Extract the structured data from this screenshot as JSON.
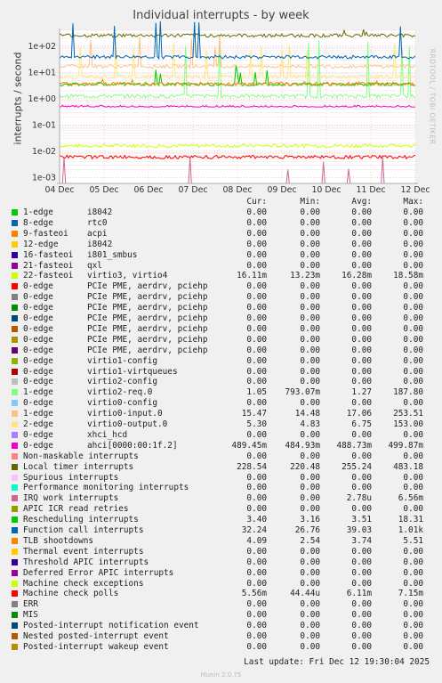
{
  "chart_data": {
    "type": "line",
    "title": "Individual interrupts - by week",
    "ylabel": "interrupts / second",
    "yscale": "log",
    "ylim": [
      0.0006,
      400
    ],
    "yticks": [
      "1e+02",
      "1e+01",
      "1e+00",
      "1e-01",
      "1e-02",
      "1e-03"
    ],
    "xticks": [
      "04 Dec",
      "05 Dec",
      "06 Dec",
      "07 Dec",
      "08 Dec",
      "09 Dec",
      "10 Dec",
      "11 Dec",
      "12 Dec"
    ],
    "grid": true,
    "columns": [
      "Cur:",
      "Min:",
      "Avg:",
      "Max:"
    ],
    "series": [
      {
        "name": "1-edge",
        "desc": "i8042",
        "color": "#00cc00",
        "cur": "0.00",
        "min": "0.00",
        "avg": "0.00",
        "max": "0.00"
      },
      {
        "name": "8-edge",
        "desc": "rtc0",
        "color": "#0066b3",
        "cur": "0.00",
        "min": "0.00",
        "avg": "0.00",
        "max": "0.00"
      },
      {
        "name": "9-fasteoi",
        "desc": "acpi",
        "color": "#ff8000",
        "cur": "0.00",
        "min": "0.00",
        "avg": "0.00",
        "max": "0.00"
      },
      {
        "name": "12-edge",
        "desc": "i8042",
        "color": "#ffcc00",
        "cur": "0.00",
        "min": "0.00",
        "avg": "0.00",
        "max": "0.00"
      },
      {
        "name": "16-fasteoi",
        "desc": "i801_smbus",
        "color": "#330099",
        "cur": "0.00",
        "min": "0.00",
        "avg": "0.00",
        "max": "0.00"
      },
      {
        "name": "21-fasteoi",
        "desc": "qxl",
        "color": "#990099",
        "cur": "0.00",
        "min": "0.00",
        "avg": "0.00",
        "max": "0.00"
      },
      {
        "name": "22-fasteoi",
        "desc": "virtio3, virtio4",
        "color": "#ccff00",
        "cur": "16.11m",
        "min": "13.23m",
        "avg": "16.28m",
        "max": "18.58m"
      },
      {
        "name": "0-edge",
        "desc": "PCIe PME, aerdrv, pciehp",
        "color": "#ff0000",
        "cur": "0.00",
        "min": "0.00",
        "avg": "0.00",
        "max": "0.00"
      },
      {
        "name": "0-edge",
        "desc": "PCIe PME, aerdrv, pciehp",
        "color": "#808080",
        "cur": "0.00",
        "min": "0.00",
        "avg": "0.00",
        "max": "0.00"
      },
      {
        "name": "0-edge",
        "desc": "PCIe PME, aerdrv, pciehp",
        "color": "#008f00",
        "cur": "0.00",
        "min": "0.00",
        "avg": "0.00",
        "max": "0.00"
      },
      {
        "name": "0-edge",
        "desc": "PCIe PME, aerdrv, pciehp",
        "color": "#00487d",
        "cur": "0.00",
        "min": "0.00",
        "avg": "0.00",
        "max": "0.00"
      },
      {
        "name": "0-edge",
        "desc": "PCIe PME, aerdrv, pciehp",
        "color": "#b35a00",
        "cur": "0.00",
        "min": "0.00",
        "avg": "0.00",
        "max": "0.00"
      },
      {
        "name": "0-edge",
        "desc": "PCIe PME, aerdrv, pciehp",
        "color": "#b38f00",
        "cur": "0.00",
        "min": "0.00",
        "avg": "0.00",
        "max": "0.00"
      },
      {
        "name": "0-edge",
        "desc": "PCIe PME, aerdrv, pciehp",
        "color": "#6b006b",
        "cur": "0.00",
        "min": "0.00",
        "avg": "0.00",
        "max": "0.00"
      },
      {
        "name": "0-edge",
        "desc": "virtio1-config",
        "color": "#8fb300",
        "cur": "0.00",
        "min": "0.00",
        "avg": "0.00",
        "max": "0.00"
      },
      {
        "name": "0-edge",
        "desc": "virtio1-virtqueues",
        "color": "#b30000",
        "cur": "0.00",
        "min": "0.00",
        "avg": "0.00",
        "max": "0.00"
      },
      {
        "name": "0-edge",
        "desc": "virtio2-config",
        "color": "#bebebe",
        "cur": "0.00",
        "min": "0.00",
        "avg": "0.00",
        "max": "0.00"
      },
      {
        "name": "1-edge",
        "desc": "virtio2-req.0",
        "color": "#80ff80",
        "cur": "1.05",
        "min": "793.07m",
        "avg": "1.27",
        "max": "187.80"
      },
      {
        "name": "0-edge",
        "desc": "virtio0-config",
        "color": "#80c9ff",
        "cur": "0.00",
        "min": "0.00",
        "avg": "0.00",
        "max": "0.00"
      },
      {
        "name": "1-edge",
        "desc": "virtio0-input.0",
        "color": "#ffc080",
        "cur": "15.47",
        "min": "14.48",
        "avg": "17.06",
        "max": "253.51"
      },
      {
        "name": "2-edge",
        "desc": "virtio0-output.0",
        "color": "#ffe680",
        "cur": "5.30",
        "min": "4.83",
        "avg": "6.75",
        "max": "153.00"
      },
      {
        "name": "0-edge",
        "desc": "xhci_hcd",
        "color": "#aa80ff",
        "cur": "0.00",
        "min": "0.00",
        "avg": "0.00",
        "max": "0.00"
      },
      {
        "name": "0-edge",
        "desc": "ahci[0000:00:1f.2]",
        "color": "#ee00cc",
        "cur": "489.45m",
        "min": "484.93m",
        "avg": "488.73m",
        "max": "499.87m"
      },
      {
        "name": "Non-maskable interrupts",
        "desc": "",
        "color": "#ff8080",
        "cur": "0.00",
        "min": "0.00",
        "avg": "0.00",
        "max": "0.00"
      },
      {
        "name": "Local timer interrupts",
        "desc": "",
        "color": "#666600",
        "cur": "228.54",
        "min": "220.48",
        "avg": "255.24",
        "max": "483.18"
      },
      {
        "name": "Spurious interrupts",
        "desc": "",
        "color": "#ffbfff",
        "cur": "0.00",
        "min": "0.00",
        "avg": "0.00",
        "max": "0.00"
      },
      {
        "name": "Performance monitoring interrupts",
        "desc": "",
        "color": "#00ffcc",
        "cur": "0.00",
        "min": "0.00",
        "avg": "0.00",
        "max": "0.00"
      },
      {
        "name": "IRQ work interrupts",
        "desc": "",
        "color": "#cc6699",
        "cur": "0.00",
        "min": "0.00",
        "avg": "2.78u",
        "max": "6.56m"
      },
      {
        "name": "APIC ICR read retries",
        "desc": "",
        "color": "#999900",
        "cur": "0.00",
        "min": "0.00",
        "avg": "0.00",
        "max": "0.00"
      },
      {
        "name": "Rescheduling interrupts",
        "desc": "",
        "color": "#00cc00",
        "cur": "3.40",
        "min": "3.16",
        "avg": "3.51",
        "max": "18.31"
      },
      {
        "name": "Function call interrupts",
        "desc": "",
        "color": "#0066b3",
        "cur": "32.24",
        "min": "26.76",
        "avg": "39.03",
        "max": "1.01k"
      },
      {
        "name": "TLB shootdowns",
        "desc": "",
        "color": "#ff8000",
        "cur": "4.09",
        "min": "2.54",
        "avg": "3.74",
        "max": "5.51"
      },
      {
        "name": "Thermal event interrupts",
        "desc": "",
        "color": "#ffcc00",
        "cur": "0.00",
        "min": "0.00",
        "avg": "0.00",
        "max": "0.00"
      },
      {
        "name": "Threshold APIC interrupts",
        "desc": "",
        "color": "#330099",
        "cur": "0.00",
        "min": "0.00",
        "avg": "0.00",
        "max": "0.00"
      },
      {
        "name": "Deferred Error APIC interrupts",
        "desc": "",
        "color": "#990099",
        "cur": "0.00",
        "min": "0.00",
        "avg": "0.00",
        "max": "0.00"
      },
      {
        "name": "Machine check exceptions",
        "desc": "",
        "color": "#ccff00",
        "cur": "0.00",
        "min": "0.00",
        "avg": "0.00",
        "max": "0.00"
      },
      {
        "name": "Machine check polls",
        "desc": "",
        "color": "#ff0000",
        "cur": "5.56m",
        "min": "44.44u",
        "avg": "6.11m",
        "max": "7.15m"
      },
      {
        "name": "ERR",
        "desc": "",
        "color": "#808080",
        "cur": "0.00",
        "min": "0.00",
        "avg": "0.00",
        "max": "0.00"
      },
      {
        "name": "MIS",
        "desc": "",
        "color": "#008f00",
        "cur": "0.00",
        "min": "0.00",
        "avg": "0.00",
        "max": "0.00"
      },
      {
        "name": "Posted-interrupt notification event",
        "desc": "",
        "color": "#00487d",
        "cur": "0.00",
        "min": "0.00",
        "avg": "0.00",
        "max": "0.00"
      },
      {
        "name": "Nested posted-interrupt event",
        "desc": "",
        "color": "#b35a00",
        "cur": "0.00",
        "min": "0.00",
        "avg": "0.00",
        "max": "0.00"
      },
      {
        "name": "Posted-interrupt wakeup event",
        "desc": "",
        "color": "#b38f00",
        "cur": "0.00",
        "min": "0.00",
        "avg": "0.00",
        "max": "0.00"
      }
    ]
  },
  "side_label": "RRDTOOL / TOBI OETIKER",
  "last_update": "Last update: Fri Dec 12 19:30:04 2025",
  "version": "Munin 2.0.75"
}
